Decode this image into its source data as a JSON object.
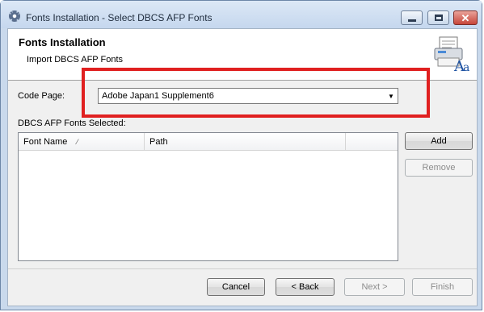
{
  "window": {
    "title": "Fonts Installation - Select DBCS AFP Fonts",
    "close_glyph": "✕"
  },
  "header": {
    "title": "Fonts Installation",
    "subtitle": "Import DBCS AFP Fonts",
    "icon": "font-install-icon"
  },
  "code_page": {
    "label": "Code Page:",
    "selected": "Adobe Japan1 Supplement6",
    "arrow": "▼"
  },
  "fonts_selected": {
    "label": "DBCS AFP Fonts Selected:",
    "columns": [
      "Font Name",
      "Path"
    ],
    "sort_glyph": "⁄",
    "rows": []
  },
  "side_buttons": {
    "add": "Add",
    "remove": "Remove"
  },
  "footer_buttons": {
    "cancel": "Cancel",
    "back": "< Back",
    "next": "Next >",
    "finish": "Finish"
  },
  "colors": {
    "highlight": "#e02020",
    "window_frame": "#c9d9ec"
  }
}
